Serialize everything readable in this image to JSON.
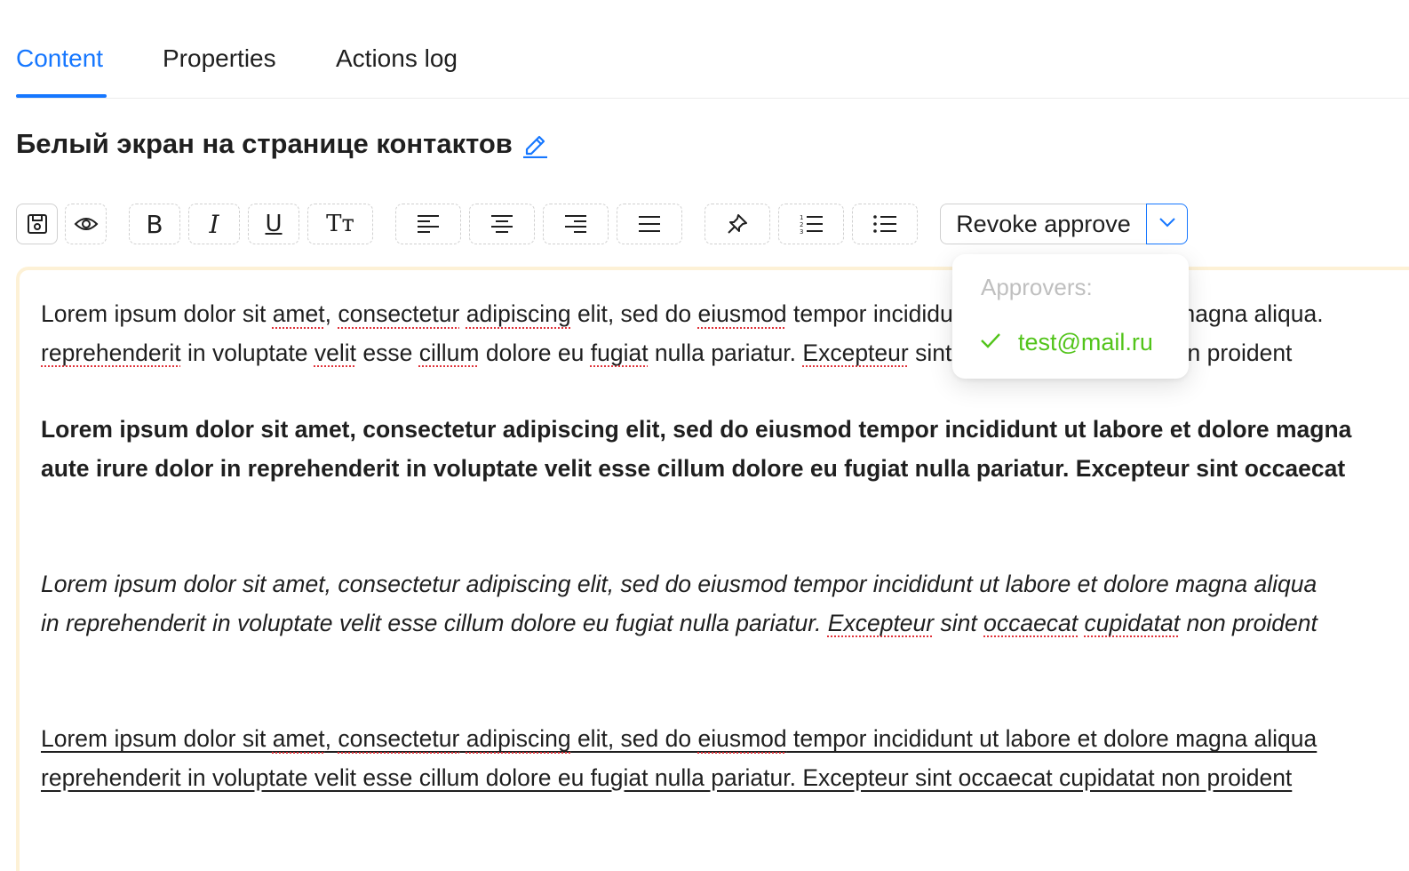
{
  "tabs": [
    {
      "label": "Content",
      "active": true
    },
    {
      "label": "Properties",
      "active": false
    },
    {
      "label": "Actions log",
      "active": false
    }
  ],
  "title": "Белый экран на странице контактов",
  "toolbar": {
    "buttons": [
      "save-icon",
      "eye-icon",
      "bold",
      "italic",
      "underline",
      "text-size",
      "align-left",
      "align-center",
      "align-right",
      "align-justify",
      "pin-icon",
      "ordered-list-icon",
      "unordered-list-icon"
    ],
    "bold_glyph": "B",
    "italic_glyph": "I",
    "underline_glyph": "U",
    "textsize_glyph": "Tт",
    "approve_label": "Revoke approve"
  },
  "approvers_dropdown": {
    "heading": "Approvers:",
    "items": [
      {
        "email": "test@mail.ru",
        "checked": true
      }
    ]
  },
  "editor": {
    "p1": {
      "l1": [
        {
          "t": "Lorem ipsum dolor sit "
        },
        {
          "t": "amet",
          "s": 1
        },
        {
          "t": ", "
        },
        {
          "t": "consectetur",
          "s": 1
        },
        {
          "t": " "
        },
        {
          "t": "adipiscing",
          "s": 1
        },
        {
          "t": " elit, sed do "
        },
        {
          "t": "eiusmod",
          "s": 1
        },
        {
          "t": " tempor incididunt ut labore et dolore magna aliqua."
        }
      ],
      "l2": [
        {
          "t": "reprehenderit",
          "s": 1
        },
        {
          "t": " in voluptate "
        },
        {
          "t": "velit",
          "s": 1
        },
        {
          "t": " esse "
        },
        {
          "t": "cillum",
          "s": 1
        },
        {
          "t": " dolore eu "
        },
        {
          "t": "fugiat",
          "s": 1
        },
        {
          "t": " nulla pariatur. "
        },
        {
          "t": "Excepteur",
          "s": 1
        },
        {
          "t": " sint "
        },
        {
          "t": "occaecat",
          "s": 1
        },
        {
          "t": " "
        },
        {
          "t": "cupidatat",
          "s": 1
        },
        {
          "t": " non proident"
        }
      ]
    },
    "p2": {
      "l1": "Lorem ipsum dolor sit amet, consectetur adipiscing elit, sed do eiusmod tempor incididunt ut labore et dolore magna",
      "l2": "aute irure dolor in reprehenderit in voluptate velit esse cillum dolore eu fugiat nulla pariatur. Excepteur sint occaecat"
    },
    "p3": {
      "l1": [
        {
          "t": "Lorem ipsum dolor sit amet, consectetur adipiscing elit, sed do eiusmod tempor incididunt ut labore et dolore magna aliqua"
        }
      ],
      "l2": [
        {
          "t": "in reprehenderit in voluptate velit esse cillum dolore eu fugiat nulla pariatur. "
        },
        {
          "t": "Excepteur",
          "s": 1
        },
        {
          "t": " sint "
        },
        {
          "t": "occaecat",
          "s": 1
        },
        {
          "t": " "
        },
        {
          "t": "cupidatat",
          "s": 1
        },
        {
          "t": " non proident"
        }
      ]
    },
    "p4": {
      "l1": [
        {
          "t": "Lorem ipsum dolor sit "
        },
        {
          "t": "amet",
          "s": 1
        },
        {
          "t": ", "
        },
        {
          "t": "consectetur",
          "s": 1
        },
        {
          "t": " "
        },
        {
          "t": "adipiscing",
          "s": 1
        },
        {
          "t": " elit, sed do "
        },
        {
          "t": "eiusmod",
          "s": 1
        },
        {
          "t": " tempor incididunt ut labore et dolore magna aliqua"
        }
      ],
      "l2": [
        {
          "t": "reprehenderit in voluptate velit esse cillum dolore eu fugiat nulla pariatur. Excepteur sint occaecat cupidatat non proident"
        }
      ]
    }
  },
  "colors": {
    "accent": "#1677ff",
    "success": "#52c41a",
    "editor_border": "#fdf1d6",
    "spellcheck": "#e0333a"
  }
}
